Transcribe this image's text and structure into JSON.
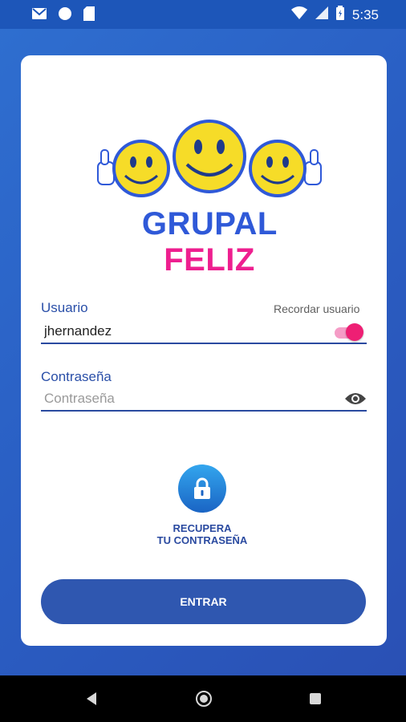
{
  "status_bar": {
    "time": "5:35",
    "left_icons": [
      "gmail-icon",
      "sync-icon",
      "sd-card-icon"
    ],
    "right_icons": [
      "wifi-icon",
      "signal-icon",
      "battery-icon"
    ]
  },
  "brand": {
    "word1": "GRUPAL",
    "word2": "FELIZ",
    "colors": {
      "blue": "#2f59d8",
      "pink": "#ee1f8f",
      "smiley": "#f6dc28"
    }
  },
  "form": {
    "username_label": "Usuario",
    "remember_label": "Recordar usuario",
    "username_value": "jhernandez",
    "remember_enabled": true,
    "password_label": "Contraseña",
    "password_placeholder": "Contraseña"
  },
  "recover": {
    "line1": "RECUPERA",
    "line2": "TU CONTRASEÑA"
  },
  "submit": {
    "label": "ENTRAR"
  },
  "nav_bar": {
    "icons": [
      "back-icon",
      "home-icon",
      "recent-apps-icon"
    ]
  },
  "colors": {
    "primary": "#2f57b0",
    "accent": "#ee1f74",
    "background": "#2a5fc4"
  }
}
